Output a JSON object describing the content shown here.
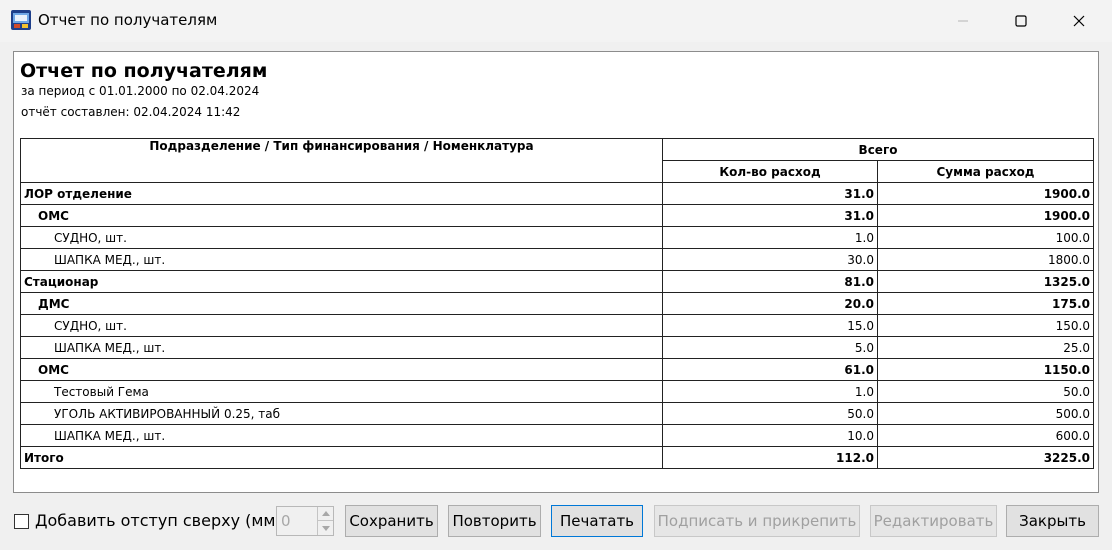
{
  "window": {
    "title": "Отчет по получателям"
  },
  "report": {
    "title": "Отчет по получателям",
    "period": "за период с 01.01.2000 по 02.04.2024",
    "created": "отчёт составлен: 02.04.2024 11:42",
    "table": {
      "header_main": "Подразделение / Тип финансирования / Номенклатура",
      "header_group": "Всего",
      "header_qty": "Кол-во расход",
      "header_sum": "Сумма расход",
      "rows": [
        {
          "level": 0,
          "name": "ЛОР отделение",
          "qty": "31.0",
          "sum": "1900.0"
        },
        {
          "level": 1,
          "name": "ОМС",
          "qty": "31.0",
          "sum": "1900.0"
        },
        {
          "level": 2,
          "name": "СУДНО, шт.",
          "qty": "1.0",
          "sum": "100.0"
        },
        {
          "level": 2,
          "name": "ШАПКА МЕД., шт.",
          "qty": "30.0",
          "sum": "1800.0"
        },
        {
          "level": 0,
          "name": "Стационар",
          "qty": "81.0",
          "sum": "1325.0"
        },
        {
          "level": 1,
          "name": "ДМС",
          "qty": "20.0",
          "sum": "175.0"
        },
        {
          "level": 2,
          "name": "СУДНО, шт.",
          "qty": "15.0",
          "sum": "150.0"
        },
        {
          "level": 2,
          "name": "ШАПКА МЕД., шт.",
          "qty": "5.0",
          "sum": "25.0"
        },
        {
          "level": 1,
          "name": "ОМС",
          "qty": "61.0",
          "sum": "1150.0"
        },
        {
          "level": 2,
          "name": "Тестовый Гема",
          "qty": "1.0",
          "sum": "50.0"
        },
        {
          "level": 2,
          "name": "УГОЛЬ АКТИВИРОВАННЫЙ 0.25, таб",
          "qty": "50.0",
          "sum": "500.0"
        },
        {
          "level": 2,
          "name": "ШАПКА МЕД., шт.",
          "qty": "10.0",
          "sum": "600.0"
        }
      ],
      "total": {
        "name": "Итого",
        "qty": "112.0",
        "sum": "3225.0"
      }
    }
  },
  "controls": {
    "offset_checkbox_label": "Добавить отступ сверху (мм)",
    "offset_value": "0",
    "save_label": "Сохранить",
    "repeat_label": "Повторить",
    "print_label": "Печатать",
    "sign_attach_label": "Подписать и прикрепить",
    "edit_label": "Редактировать",
    "close_label": "Закрыть"
  }
}
